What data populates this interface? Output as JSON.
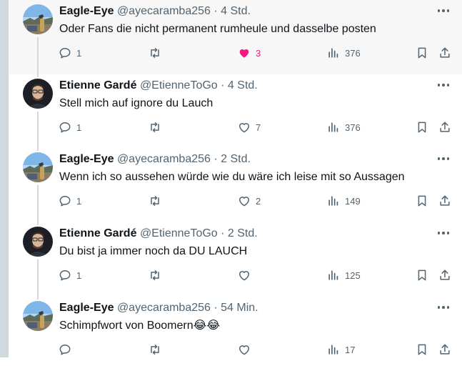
{
  "tweets": [
    {
      "name": "Eagle-Eye",
      "handle": "@ayecaramba256",
      "sep": "·",
      "time": "4 Std.",
      "text": "Oder Fans die nicht permanent rumheule und dasselbe posten",
      "replies": "1",
      "retweets": "",
      "likes": "3",
      "liked": true,
      "views": "376",
      "avatar": "landscape",
      "highlight": true
    },
    {
      "name": "Etienne Gardé",
      "handle": "@EtienneToGo",
      "sep": "·",
      "time": "4 Std.",
      "text": "Stell mich auf ignore du Lauch",
      "replies": "1",
      "retweets": "",
      "likes": "7",
      "liked": false,
      "views": "376",
      "avatar": "person",
      "highlight": false
    },
    {
      "name": "Eagle-Eye",
      "handle": "@ayecaramba256",
      "sep": "·",
      "time": "2 Std.",
      "text": "Wenn ich so aussehen würde wie du wäre ich leise mit so Aussagen",
      "replies": "1",
      "retweets": "",
      "likes": "2",
      "liked": false,
      "views": "149",
      "avatar": "landscape",
      "highlight": false
    },
    {
      "name": "Etienne Gardé",
      "handle": "@EtienneToGo",
      "sep": "·",
      "time": "2 Std.",
      "text": "Du bist ja immer noch da DU LAUCH",
      "replies": "1",
      "retweets": "",
      "likes": "",
      "liked": false,
      "views": "125",
      "avatar": "person",
      "highlight": false
    },
    {
      "name": "Eagle-Eye",
      "handle": "@ayecaramba256",
      "sep": "·",
      "time": "54 Min.",
      "text": "Schimpfwort von Boomern😂😂",
      "replies": "",
      "retweets": "",
      "likes": "",
      "liked": false,
      "views": "17",
      "avatar": "landscape",
      "highlight": false
    }
  ],
  "colors": {
    "muted": "#536471",
    "like": "#f91880",
    "thread": "#cfd9de"
  },
  "icons": [
    "reply-icon",
    "retweet-icon",
    "heart-icon",
    "views-icon",
    "bookmark-icon",
    "share-icon",
    "more-icon"
  ]
}
